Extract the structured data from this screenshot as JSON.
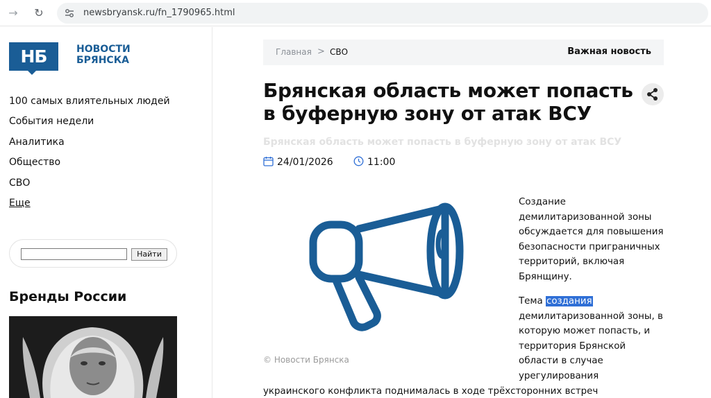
{
  "browser": {
    "url": "newsbryansk.ru/fn_1790965.html"
  },
  "site": {
    "logo_mark": "НБ",
    "logo_line1": "НОВОСТИ",
    "logo_line2": "БРЯНСКА",
    "brand_color": "#1a5d96"
  },
  "sidebar": {
    "items": [
      {
        "label": "100 самых влиятельных людей"
      },
      {
        "label": "События недели"
      },
      {
        "label": "Аналитика"
      },
      {
        "label": "Общество"
      },
      {
        "label": "СВО"
      },
      {
        "label": "Еще"
      }
    ],
    "search_button": "Найти",
    "search_value": "",
    "brands_title": "Бренды России"
  },
  "breadcrumb": {
    "home": "Главная",
    "separator": ">",
    "current": "СВО",
    "flag": "Важная новость"
  },
  "article": {
    "title": "Брянская область может попасть в буферную зону от атак ВСУ",
    "subtitle": "Брянская область может попасть в буферную зону от атак ВСУ",
    "date": "24/01/2026",
    "time": "11:00",
    "image_caption": "© Новости Брянска",
    "paragraph1": "Создание демилитаризованной зоны обсуждается для повышения безопасности приграничных территорий, включая Брянщину.",
    "p2_start": "Тема ",
    "p2_highlight": "создания",
    "p2_rest": " демилитаризованной зоны, в которую может попасть, и территория Брянской области в случае урегулирования",
    "p2_bottom": "украинского конфликта поднималась в ходе трёхсторонних встреч"
  },
  "icons": {
    "forward": "arrow-right-icon",
    "reload": "reload-icon",
    "site_info": "tune-icon",
    "share": "share-icon",
    "calendar": "calendar-icon",
    "clock": "clock-icon",
    "megaphone": "megaphone-icon"
  }
}
